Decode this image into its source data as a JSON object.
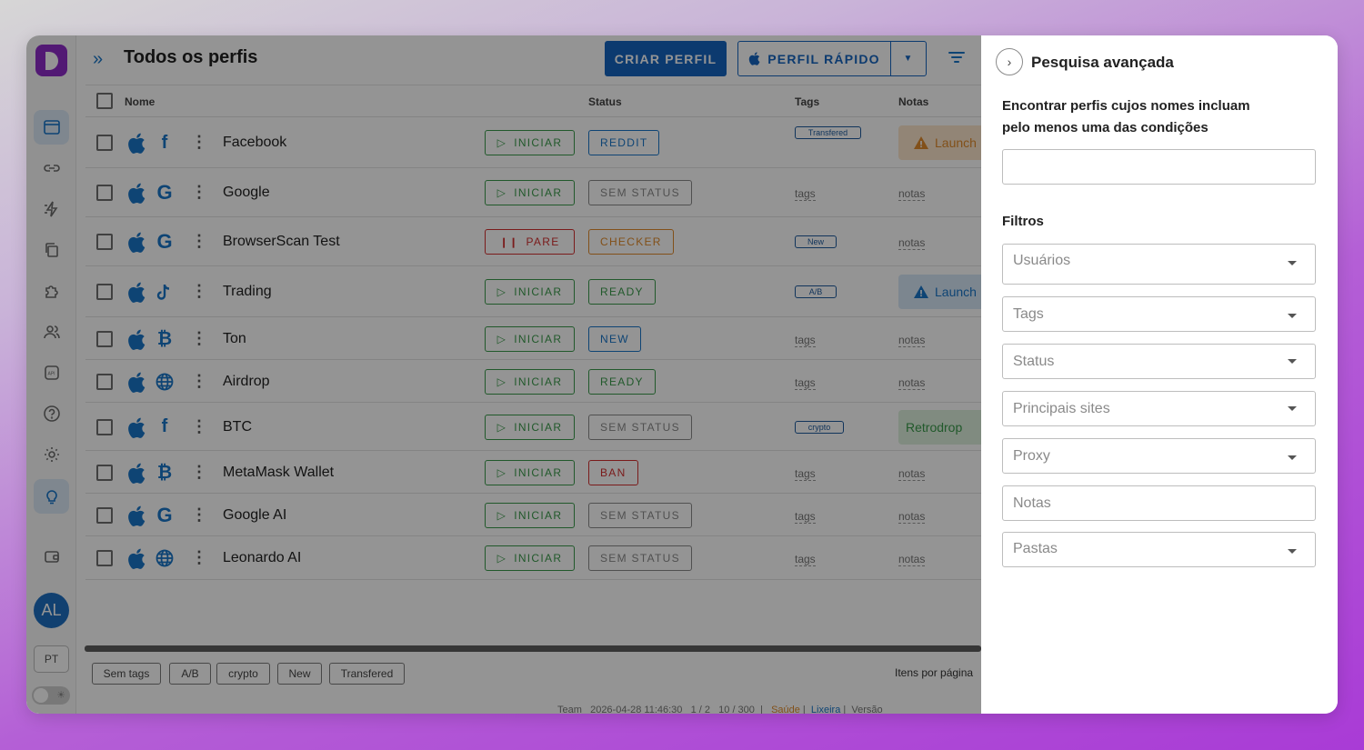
{
  "header": {
    "title": "Todos os perfis",
    "create_label": "CRIAR PERFIL",
    "quick_label": "PERFIL RÁPIDO"
  },
  "sidebar": {
    "avatar_initials": "AL",
    "language": "PT"
  },
  "table": {
    "columns": {
      "name": "Nome",
      "status": "Status",
      "tags": "Tags",
      "notes": "Notas"
    },
    "rows": [
      {
        "name": "Facebook",
        "site": "facebook-icon",
        "action": "INICIAR",
        "status": "REDDIT",
        "status_color": "#1976c9",
        "tag": "Transfered",
        "note": "Launch",
        "note_style": "warning-orange"
      },
      {
        "name": "Google",
        "site": "google-icon",
        "action": "INICIAR",
        "status": "SEM STATUS",
        "status_color": "#8a8a8a",
        "tag": "tags",
        "note": "notas"
      },
      {
        "name": "BrowserScan Test",
        "site": "google-icon",
        "action": "PARE",
        "status": "CHECKER",
        "status_color": "#e08b2c",
        "tag": "New",
        "note": "notas"
      },
      {
        "name": "Trading",
        "site": "tiktok-icon",
        "action": "INICIAR",
        "status": "READY",
        "status_color": "#3a9a4a",
        "tag": "A/B",
        "note": "Launch",
        "note_style": "warning-blue"
      },
      {
        "name": "Ton",
        "site": "bitcoin-icon",
        "action": "INICIAR",
        "status": "NEW",
        "status_color": "#1976c9",
        "tag": "tags",
        "note": "notas"
      },
      {
        "name": "Airdrop",
        "site": "globe-icon",
        "action": "INICIAR",
        "status": "READY",
        "status_color": "#3a9a4a",
        "tag": "tags",
        "note": "notas"
      },
      {
        "name": "BTC",
        "site": "facebook-icon",
        "action": "INICIAR",
        "status": "SEM STATUS",
        "status_color": "#8a8a8a",
        "tag": "crypto",
        "note": "Retrodrop",
        "note_style": "success-green"
      },
      {
        "name": "MetaMask Wallet",
        "site": "bitcoin-icon",
        "action": "INICIAR",
        "status": "BAN",
        "status_color": "#d32f2f",
        "tag": "tags",
        "note": "notas"
      },
      {
        "name": "Google AI",
        "site": "google-icon",
        "action": "INICIAR",
        "status": "SEM STATUS",
        "status_color": "#8a8a8a",
        "tag": "tags",
        "note": "notas"
      },
      {
        "name": "Leonardo AI",
        "site": "globe-icon",
        "action": "INICIAR",
        "status": "SEM STATUS",
        "status_color": "#8a8a8a",
        "tag": "tags",
        "note": "notas"
      }
    ]
  },
  "tag_chips": [
    "Sem tags",
    "A/B",
    "crypto",
    "New",
    "Transfered"
  ],
  "pagination": {
    "per_page_label": "Itens por página"
  },
  "footer": {
    "team": "Team",
    "datetime": "2026-04-28 11:46:30",
    "users": "1 / 2",
    "profiles": "10 / 300",
    "exit": "Saúde",
    "trash": "Lixeira",
    "version": "Versão"
  },
  "panel": {
    "title": "Pesquisa avançada",
    "description": "Encontrar perfis cujos nomes incluam pelo menos uma das condições",
    "filters_label": "Filtros",
    "fields": {
      "users": "Usuários",
      "tags": "Tags",
      "status": "Status",
      "sites": "Principais sites",
      "proxy": "Proxy",
      "notes": "Notas",
      "folders": "Pastas"
    }
  }
}
